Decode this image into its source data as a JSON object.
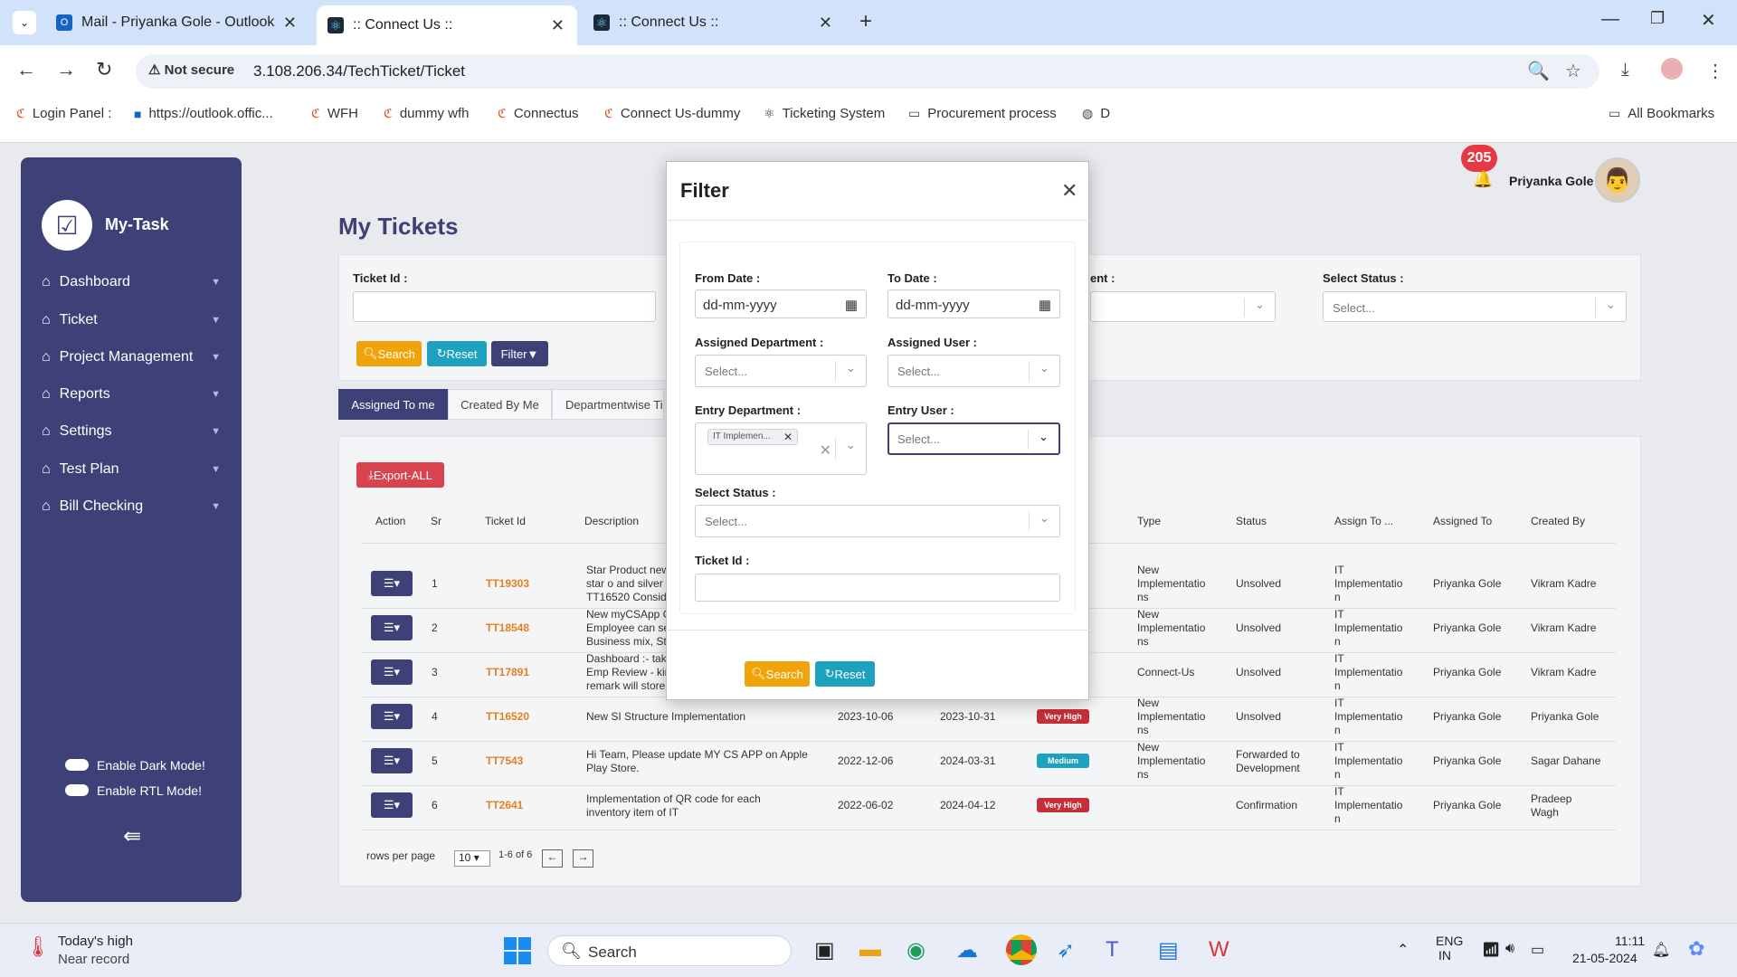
{
  "browser": {
    "tabs": [
      {
        "label": "Mail - Priyanka Gole - Outlook",
        "icon": "outlook-icon"
      },
      {
        "label": ":: Connect Us ::",
        "icon": "react-icon"
      },
      {
        "label": ":: Connect Us ::",
        "icon": "react-icon"
      }
    ],
    "security": "Not secure",
    "url": "3.108.206.34/TechTicket/Ticket",
    "bookmarks": [
      "Login Panel :",
      "https://outlook.offic...",
      "WFH",
      "dummy wfh",
      "Connectus",
      "Connect Us-dummy",
      "Ticketing System",
      "Procurement process",
      "D"
    ],
    "all_bookmarks": "All Bookmarks"
  },
  "app": {
    "logo": "My-Task",
    "sidebar": [
      {
        "label": "Dashboard"
      },
      {
        "label": "Ticket"
      },
      {
        "label": "Project Management"
      },
      {
        "label": "Reports"
      },
      {
        "label": "Settings"
      },
      {
        "label": "Test Plan"
      },
      {
        "label": "Bill Checking"
      }
    ],
    "dark_mode": "Enable Dark Mode!",
    "rtl_mode": "Enable RTL Mode!",
    "user": "Priyanka Gole",
    "notifications": "205",
    "page_title": "My Tickets",
    "filter": {
      "ticket_id_label": "Ticket Id :",
      "assignment_label": "ent :",
      "select_status_label": "Select Status :",
      "select_placeholder": "Select...",
      "search": "Search",
      "reset": "Reset",
      "filter": "Filter"
    },
    "tabs": [
      "Assigned To me",
      "Created By Me",
      "Departmentwise Ti"
    ],
    "export": "Export-ALL",
    "columns": [
      "Action",
      "Sr",
      "Ticket Id",
      "Description",
      "Type",
      "Status",
      "Assign To ...",
      "Assigned To",
      "Created By"
    ],
    "rows": [
      {
        "sr": "1",
        "id": "TT19303",
        "desc": [
          "Star Product new",
          "star o and silver c",
          "TT16520 Conside"
        ],
        "start": "",
        "end": "",
        "priority": "",
        "type": [
          "New",
          "Implementatio",
          "ns"
        ],
        "status": [
          "Unsolved"
        ],
        "assign_to": [
          "IT",
          "Implementatio",
          "n"
        ],
        "assigned": "Priyanka Gole",
        "created": [
          "Vikram Kadre"
        ]
      },
      {
        "sr": "2",
        "id": "TT18548",
        "desc": [
          "New myCSApp C",
          "Employee can se",
          "Business mix, Sta"
        ],
        "start": "",
        "end": "",
        "priority": "",
        "type": [
          "New",
          "Implementatio",
          "ns"
        ],
        "status": [
          "Unsolved"
        ],
        "assign_to": [
          "IT",
          "Implementatio",
          "n"
        ],
        "assigned": "Priyanka Gole",
        "created": [
          "Vikram Kadre"
        ]
      },
      {
        "sr": "3",
        "id": "TT17891",
        "desc": [
          "Dashboard :- tak",
          "Emp Review - kin",
          "remark will store"
        ],
        "start": "",
        "end": "",
        "priority": "",
        "type": [
          "Connect-Us"
        ],
        "status": [
          "Unsolved"
        ],
        "assign_to": [
          "IT",
          "Implementatio",
          "n"
        ],
        "assigned": "Priyanka Gole",
        "created": [
          "Vikram Kadre"
        ]
      },
      {
        "sr": "4",
        "id": "TT16520",
        "desc": [
          "New SI Structure Implementation"
        ],
        "start": "2023-10-06",
        "end": "2023-10-31",
        "priority": "Very High",
        "type": [
          "New",
          "Implementatio",
          "ns"
        ],
        "status": [
          "Unsolved"
        ],
        "assign_to": [
          "IT",
          "Implementatio",
          "n"
        ],
        "assigned": "Priyanka Gole",
        "created": [
          "Priyanka Gole"
        ]
      },
      {
        "sr": "5",
        "id": "TT7543",
        "desc": [
          "Hi Team, Please update MY CS APP on Apple",
          "Play Store."
        ],
        "start": "2022-12-06",
        "end": "2024-03-31",
        "priority": "Medium",
        "type": [
          "New",
          "Implementatio",
          "ns"
        ],
        "status": [
          "Forwarded to",
          "Development"
        ],
        "assign_to": [
          "IT",
          "Implementatio",
          "n"
        ],
        "assigned": "Priyanka Gole",
        "created": [
          "Sagar Dahane"
        ]
      },
      {
        "sr": "6",
        "id": "TT2641",
        "desc": [
          "Implementation of QR code for each",
          "inventory item of IT"
        ],
        "start": "2022-06-02",
        "end": "2024-04-12",
        "priority": "Very High",
        "type": [
          ""
        ],
        "status": [
          "Confirmation"
        ],
        "assign_to": [
          "IT",
          "Implementatio",
          "n"
        ],
        "assigned": "Priyanka Gole",
        "created": [
          "Pradeep",
          "Wagh"
        ]
      }
    ],
    "pager": {
      "label": "rows per page",
      "size": "10",
      "range": "1-6 of 6"
    }
  },
  "modal": {
    "title": "Filter",
    "from_date_label": "From Date :",
    "to_date_label": "To Date :",
    "date_placeholder": "dd-mm-yyyy",
    "assigned_dept_label": "Assigned Department :",
    "assigned_user_label": "Assigned User :",
    "entry_dept_label": "Entry Department :",
    "entry_user_label": "Entry User :",
    "status_label": "Select Status :",
    "ticket_id_label": "Ticket Id :",
    "placeholder": "Select...",
    "entry_dept_chip": "IT Implemen...",
    "search": "Search",
    "reset": "Reset"
  },
  "taskbar": {
    "weather_title": "Today's high",
    "weather_sub": "Near record",
    "search": "Search",
    "lang1": "ENG",
    "lang2": "IN",
    "time": "11:11",
    "date": "21-05-2024"
  },
  "colors": {
    "sidebar": "#3d4177",
    "accent": "#f0a30a",
    "teal": "#1ea1bf",
    "danger": "#d9434e"
  }
}
